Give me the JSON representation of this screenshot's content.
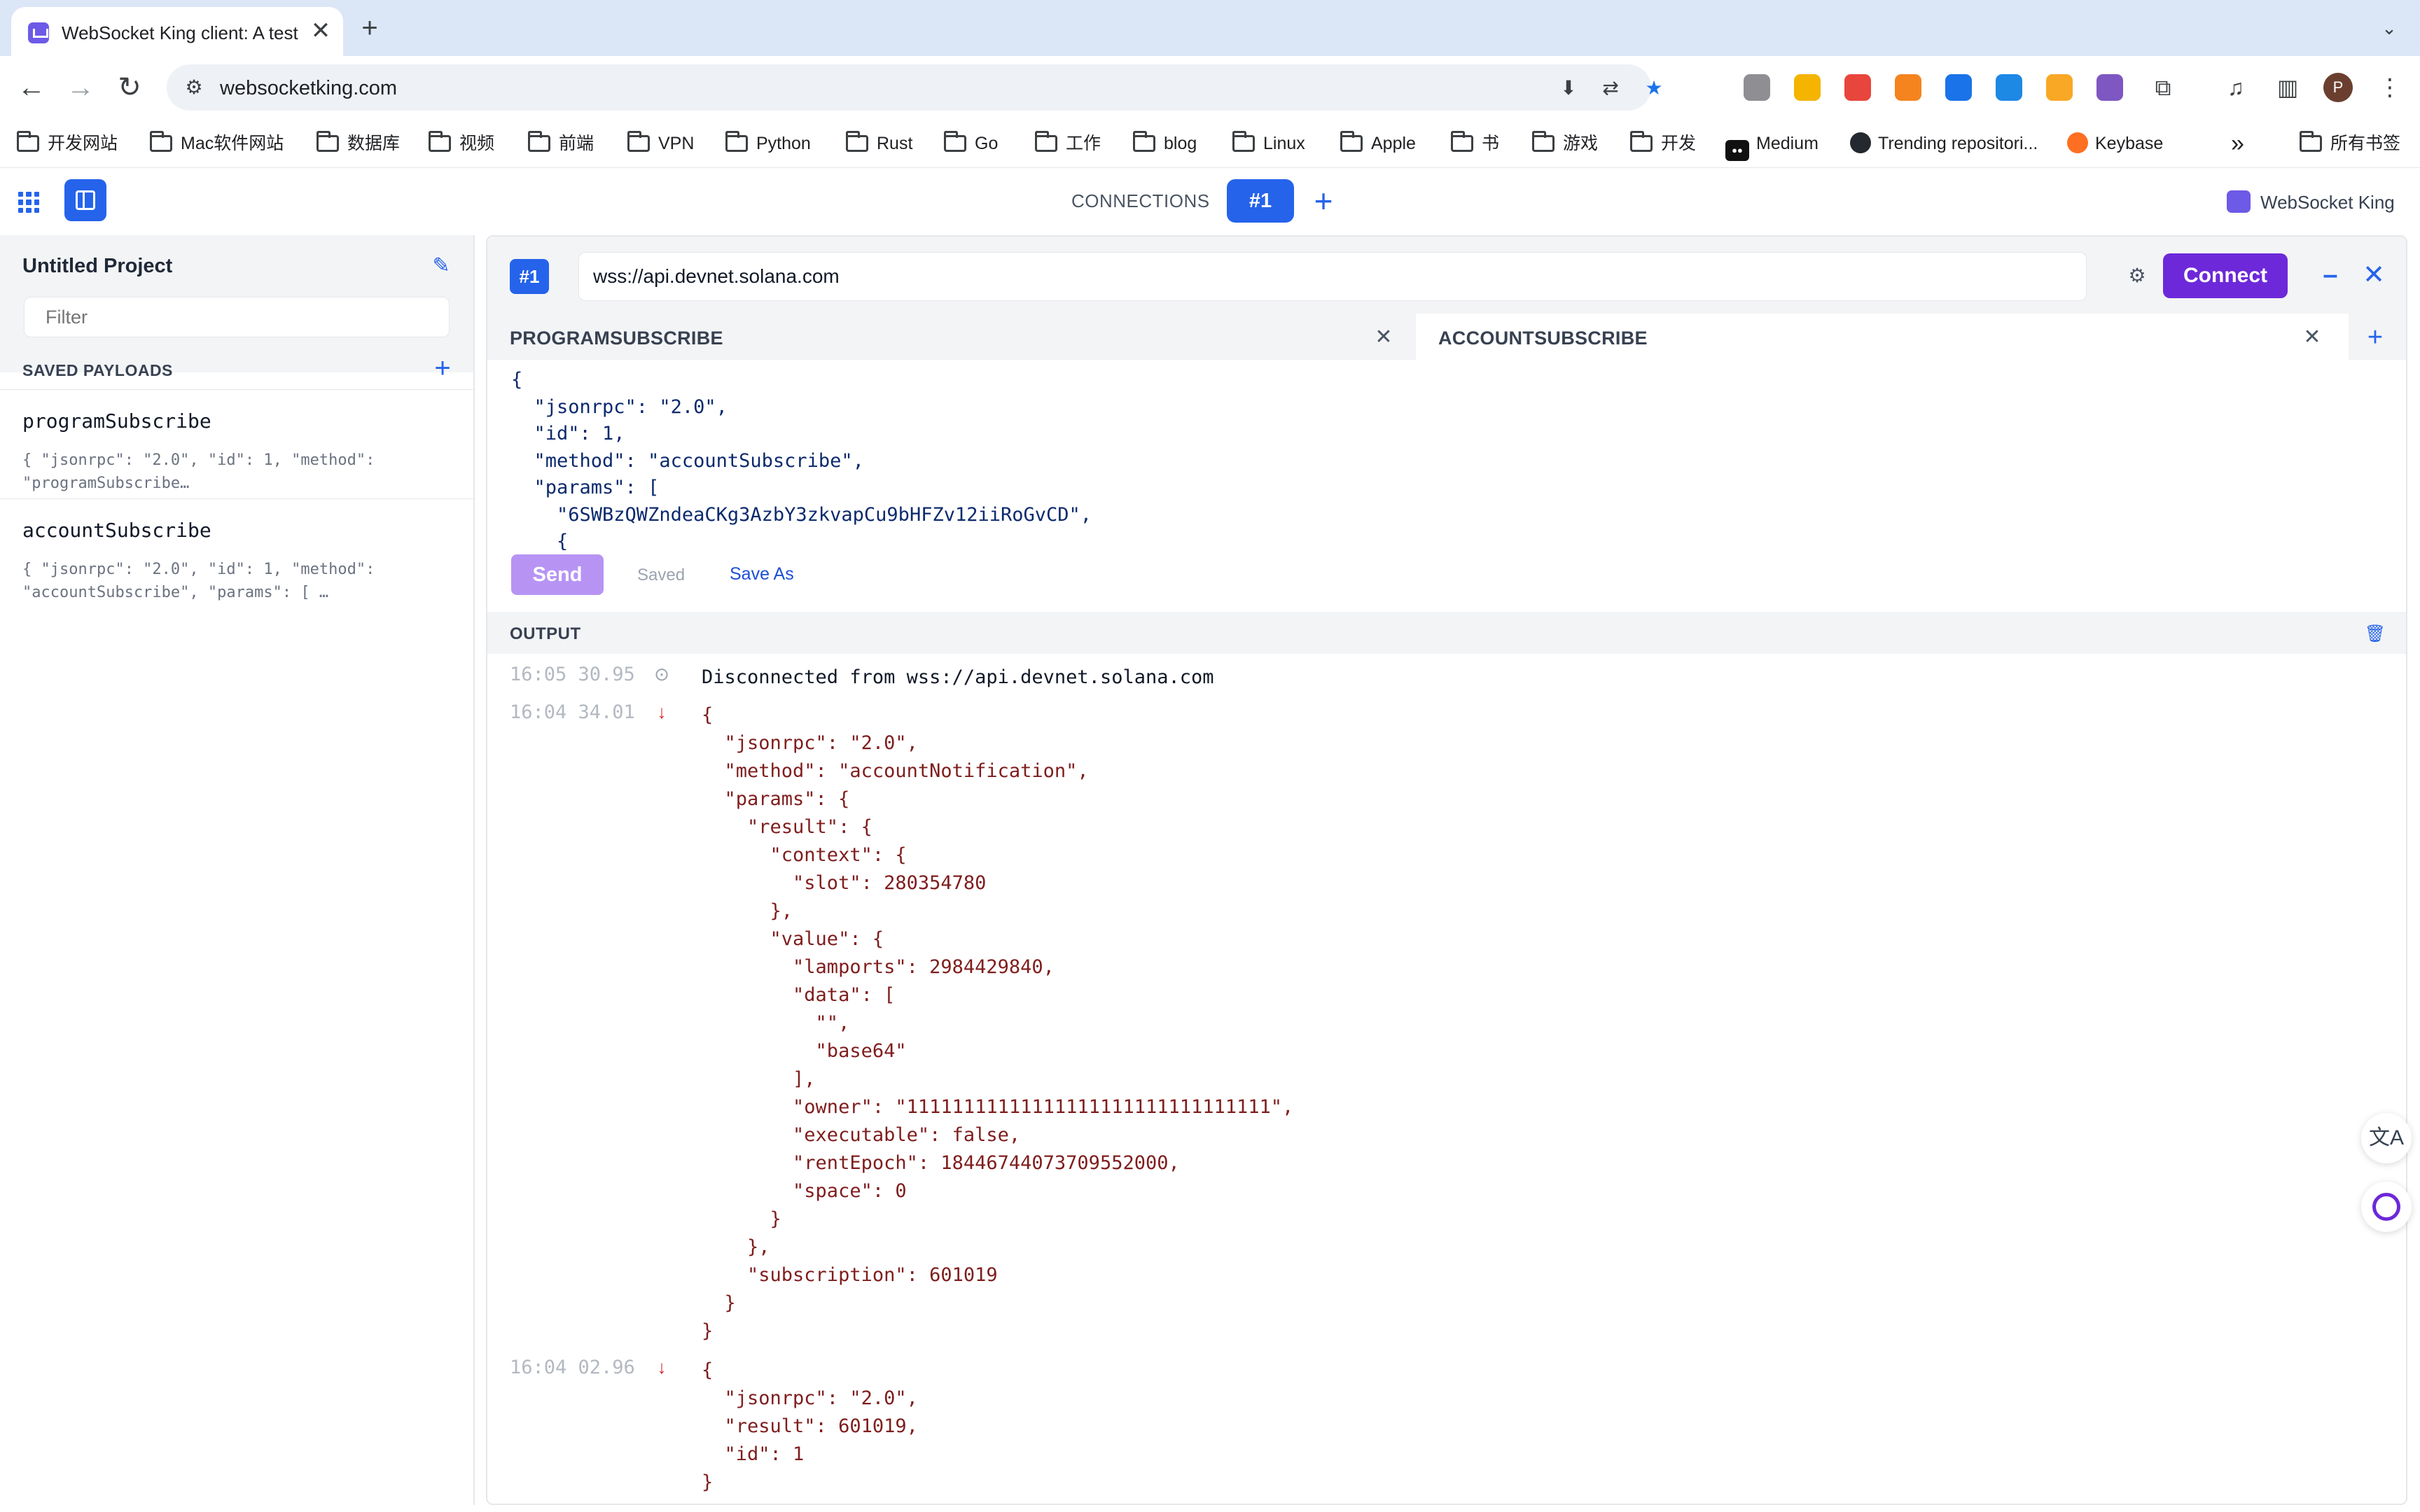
{
  "browser": {
    "tab_title": "WebSocket King client: A test",
    "tab_close": "✕",
    "new_tab": "+",
    "tab_menu": "⌄",
    "url": "websocketking.com",
    "extensions": [
      "#8e8e93",
      "#f4b400",
      "#e8453c",
      "#f5841f",
      "#1a73e8",
      "#1e88e5",
      "#f9a825",
      "#7e57c2"
    ],
    "profile_initial": "P"
  },
  "bookmarks": [
    {
      "label": "开发网站",
      "type": "folder"
    },
    {
      "label": "Mac软件网站",
      "type": "folder"
    },
    {
      "label": "数据库",
      "type": "folder"
    },
    {
      "label": "视频",
      "type": "folder"
    },
    {
      "label": "前端",
      "type": "folder"
    },
    {
      "label": "VPN",
      "type": "folder"
    },
    {
      "label": "Python",
      "type": "folder"
    },
    {
      "label": "Rust",
      "type": "folder"
    },
    {
      "label": "Go",
      "type": "folder"
    },
    {
      "label": "工作",
      "type": "folder"
    },
    {
      "label": "blog",
      "type": "folder"
    },
    {
      "label": "Linux",
      "type": "folder"
    },
    {
      "label": "Apple",
      "type": "folder"
    },
    {
      "label": "书",
      "type": "folder"
    },
    {
      "label": "游戏",
      "type": "folder"
    },
    {
      "label": "开发",
      "type": "folder"
    },
    {
      "label": "Medium",
      "type": "medium"
    },
    {
      "label": "Trending repositori...",
      "type": "github"
    },
    {
      "label": "Keybase",
      "type": "keybase"
    }
  ],
  "bookmarks_more": "»",
  "bookmarks_all": "所有书签",
  "app": {
    "connections_label": "CONNECTIONS",
    "active_connection": "#1",
    "add_connection": "+",
    "brand": "WebSocket King",
    "accent": "#2563eb",
    "connect_color": "#6d28d9"
  },
  "sidebar": {
    "project_title": "Untitled Project",
    "filter_placeholder": "Filter",
    "saved_payloads_label": "SAVED PAYLOADS",
    "add": "+",
    "payloads": [
      {
        "name": "programSubscribe",
        "preview": "{ \"jsonrpc\": \"2.0\", \"id\": 1, \"method\": \"programSubscribe…"
      },
      {
        "name": "accountSubscribe",
        "preview": "{ \"jsonrpc\": \"2.0\", \"id\": 1, \"method\": \"accountSubscribe\", \"params\": [ …"
      }
    ]
  },
  "connection": {
    "badge": "#1",
    "url": "wss://api.devnet.solana.com",
    "connect_label": "Connect",
    "minimize": "–",
    "close": "✕"
  },
  "payload_tabs": [
    {
      "label": "PROGRAMSUBSCRIBE",
      "close": "✕",
      "active": false
    },
    {
      "label": "ACCOUNTSUBSCRIBE",
      "close": "✕",
      "active": true
    }
  ],
  "payload_tab_add": "+",
  "editor": {
    "lines": [
      "{",
      "  \"jsonrpc\": \"2.0\",",
      "  \"id\": 1,",
      "  \"method\": \"accountSubscribe\",",
      "  \"params\": [",
      "    \"6SWBzQWZndeaCKg3AzbY3zkvapCu9bHFZv12iiRoGvCD\",",
      "    {"
    ]
  },
  "actions": {
    "send": "Send",
    "saved": "Saved",
    "save_as": "Save As"
  },
  "output": {
    "label": "OUTPUT",
    "messages": [
      {
        "time": "16:05 30.95",
        "kind": "info",
        "icon": "⊙",
        "text": "Disconnected from wss://api.devnet.solana.com"
      },
      {
        "time": "16:04 34.01",
        "kind": "in",
        "icon": "↓",
        "text": "{\n  \"jsonrpc\": \"2.0\",\n  \"method\": \"accountNotification\",\n  \"params\": {\n    \"result\": {\n      \"context\": {\n        \"slot\": 280354780\n      },\n      \"value\": {\n        \"lamports\": 2984429840,\n        \"data\": [\n          \"\",\n          \"base64\"\n        ],\n        \"owner\": \"11111111111111111111111111111111\",\n        \"executable\": false,\n        \"rentEpoch\": 18446744073709552000,\n        \"space\": 0\n      }\n    },\n    \"subscription\": 601019\n  }\n}"
      },
      {
        "time": "16:04 02.96",
        "kind": "in",
        "icon": "↓",
        "text": "{\n  \"jsonrpc\": \"2.0\",\n  \"result\": 601019,\n  \"id\": 1\n}"
      }
    ]
  }
}
